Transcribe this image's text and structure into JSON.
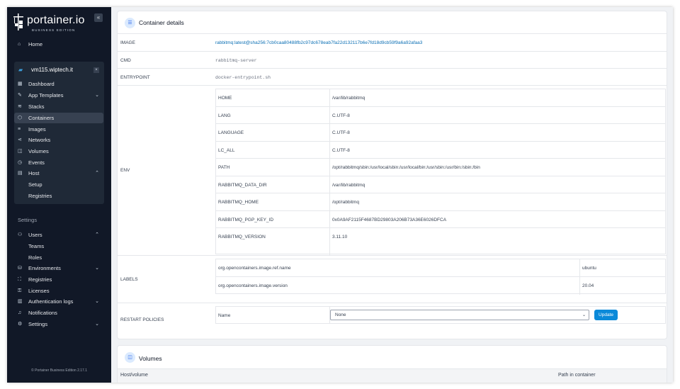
{
  "brand": {
    "name": "portainer.io",
    "edition": "BUSINESS EDITION"
  },
  "nav": {
    "home": "Home",
    "environment": "vm115.wiptech.it",
    "env_items": [
      {
        "label": "Dashboard",
        "icon": "dashboard-icon"
      },
      {
        "label": "App Templates",
        "icon": "edit-icon"
      },
      {
        "label": "Stacks",
        "icon": "stacks-icon"
      },
      {
        "label": "Containers",
        "icon": "container-icon"
      },
      {
        "label": "Images",
        "icon": "list-icon"
      },
      {
        "label": "Networks",
        "icon": "share-icon"
      },
      {
        "label": "Volumes",
        "icon": "database-icon"
      },
      {
        "label": "Events",
        "icon": "clock-icon"
      },
      {
        "label": "Host",
        "icon": "host-icon"
      }
    ],
    "host_sub": [
      "Setup",
      "Registries"
    ],
    "settings_label": "Settings",
    "settings_items": [
      {
        "label": "Users",
        "icon": "users-icon"
      },
      {
        "label": "Environments",
        "icon": "environments-icon"
      },
      {
        "label": "Registries",
        "icon": "registries-icon"
      },
      {
        "label": "Licenses",
        "icon": "key-icon"
      },
      {
        "label": "Authentication logs",
        "icon": "log-icon"
      },
      {
        "label": "Notifications",
        "icon": "bell-icon"
      },
      {
        "label": "Settings",
        "icon": "gear-icon"
      }
    ],
    "users_sub": [
      "Teams",
      "Roles"
    ],
    "footer": "Portainer Business Edition 2.17.1"
  },
  "details": {
    "title": "Container details",
    "image_label": "IMAGE",
    "image_value": "rabbitmq:latest@sha256:7cb0caa80488fb2c97dc678eab7fa22d132117b6e7fd18d9cb59f9a6a92afaa3",
    "cmd_label": "CMD",
    "cmd_value": "rabbitmq-server",
    "entrypoint_label": "ENTRYPOINT",
    "entrypoint_value": "docker-entrypoint.sh",
    "env_label": "ENV",
    "env": [
      {
        "key": "HOME",
        "value": "/var/lib/rabbitmq"
      },
      {
        "key": "LANG",
        "value": "C.UTF-8"
      },
      {
        "key": "LANGUAGE",
        "value": "C.UTF-8"
      },
      {
        "key": "LC_ALL",
        "value": "C.UTF-8"
      },
      {
        "key": "PATH",
        "value": "/opt/rabbitmq/sbin:/usr/local/sbin:/usr/local/bin:/usr/sbin:/usr/bin:/sbin:/bin"
      },
      {
        "key": "RABBITMQ_DATA_DIR",
        "value": "/var/lib/rabbitmq"
      },
      {
        "key": "RABBITMQ_HOME",
        "value": "/opt/rabbitmq"
      },
      {
        "key": "RABBITMQ_PGP_KEY_ID",
        "value": "0x0A9AF2115F4687BD29803A206B73A36E6026DFCA"
      },
      {
        "key": "RABBITMQ_VERSION",
        "value": "3.11.10"
      }
    ],
    "labels_label": "LABELS",
    "labels": [
      {
        "key": "org.opencontainers.image.ref.name",
        "value": "ubuntu"
      },
      {
        "key": "org.opencontainers.image.version",
        "value": "20.04"
      }
    ],
    "restart_label": "RESTART POLICIES",
    "restart_name": "Name",
    "restart_value": "None",
    "update_button": "Update"
  },
  "volumes": {
    "title": "Volumes",
    "col_host": "Host/volume",
    "col_path": "Path in container"
  }
}
